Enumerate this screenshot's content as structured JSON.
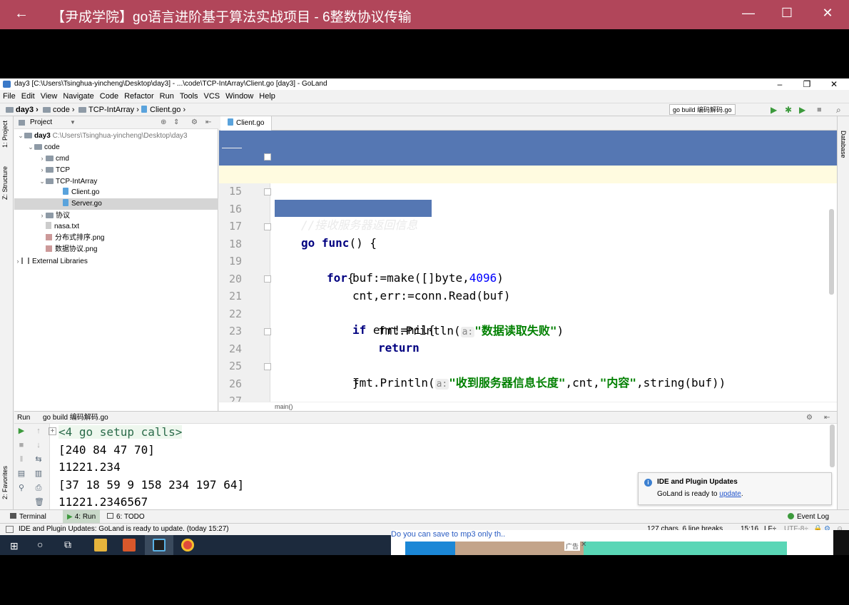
{
  "player": {
    "back_glyph": "←",
    "title": "【尹成学院】go语言进阶基于算法实战项目 - 6整数协议传输",
    "minimize": "—",
    "maximize": "☐",
    "close": "✕"
  },
  "ide": {
    "window_title": "day3 [C:\\Users\\Tsinghua-yincheng\\Desktop\\day3] - ...\\code\\TCP-IntArray\\Client.go [day3] - GoLand",
    "menu": [
      "File",
      "Edit",
      "View",
      "Navigate",
      "Code",
      "Refactor",
      "Run",
      "Tools",
      "VCS",
      "Window",
      "Help"
    ],
    "breadcrumb": [
      "day3",
      "code",
      "TCP-IntArray",
      "Client.go"
    ],
    "run_config": "go build 编码解码.go",
    "left_tabs": [
      "1: Project",
      "Z: Structure",
      "2: Favorites"
    ],
    "right_tabs": [
      "Database"
    ]
  },
  "project": {
    "header": "Project",
    "tree": [
      {
        "label": "day3",
        "path": "C:\\Users\\Tsinghua-yincheng\\Desktop\\day3",
        "kind": "folder",
        "open": true
      },
      {
        "label": "code",
        "kind": "folder",
        "open": true
      },
      {
        "label": "cmd",
        "kind": "folder",
        "open": false
      },
      {
        "label": "TCP",
        "kind": "folder",
        "open": false
      },
      {
        "label": "TCP-IntArray",
        "kind": "folder",
        "open": true
      },
      {
        "label": "Client.go",
        "kind": "go"
      },
      {
        "label": "Server.go",
        "kind": "go",
        "selected": true
      },
      {
        "label": "协议",
        "kind": "folder",
        "open": false
      },
      {
        "label": "nasa.txt",
        "kind": "file"
      },
      {
        "label": "分布式排序.png",
        "kind": "image"
      },
      {
        "label": "数据协议.png",
        "kind": "image"
      },
      {
        "label": "External Libraries",
        "kind": "lib"
      }
    ]
  },
  "editor": {
    "tab": "Client.go",
    "footer_crumb": "main()",
    "lines": [
      {
        "n": "13",
        "indent": 3
      },
      {
        "n": "14",
        "indent": 2
      },
      {
        "n": "15",
        "indent": 2
      },
      {
        "n": "16",
        "indent": 2
      },
      {
        "n": "17",
        "indent": 0
      },
      {
        "n": "18",
        "indent": 3
      },
      {
        "n": "19",
        "indent": 4
      },
      {
        "n": "20",
        "indent": 4
      },
      {
        "n": "21",
        "indent": 4
      },
      {
        "n": "22",
        "indent": 5
      },
      {
        "n": "23",
        "indent": 5
      },
      {
        "n": "24",
        "indent": 4
      },
      {
        "n": "25",
        "indent": 4
      },
      {
        "n": "26",
        "indent": 3
      },
      {
        "n": "27",
        "indent": 0
      }
    ],
    "code": {
      "l13_kw": "return",
      "l14": "}",
      "l15": "//接收服务器返回信息",
      "l16_kw": "go func",
      "l16_rest": "() {",
      "l18_kw": "for",
      "l18_rest": "{",
      "l19_a": "buf:=make([]byte,",
      "l19_num": "4096",
      "l19_b": ")",
      "l20": "cnt,err:=conn.Read(buf)",
      "l21_kw": "if",
      "l21_rest": " err!=nil{",
      "l22_a": "fmt.Println(",
      "l22_hint": "a:",
      "l22_str": "\"数据读取失败\"",
      "l22_b": ")",
      "l23_kw": "return",
      "l24": "}",
      "l25_a": "fmt.Println(",
      "l25_hint": "a:",
      "l25_str1": "\"收到服务器信息长度\"",
      "l25_mid": ",cnt,",
      "l25_str2": "\"内容\"",
      "l25_b": ",string(buf))",
      "l26": "}"
    }
  },
  "run": {
    "tab_label": "Run",
    "config": "go build 编码解码.go",
    "output": [
      "<4 go setup calls>",
      "[240 84 47 70]",
      "11221.234",
      "[37 18 59 9 158 234 197 64]",
      "11221.2346567"
    ]
  },
  "notification": {
    "title": "IDE and Plugin Updates",
    "body": "GoLand is ready to",
    "link": "update",
    "tail": "."
  },
  "bottom_tabs": [
    "Terminal",
    "4: Run",
    "6: TODO"
  ],
  "event_log": "Event Log",
  "status": {
    "message": "IDE and Plugin Updates: GoLand is ready to update. (today 15:27)",
    "chars": "127 chars, 6 line breaks",
    "position": "15:16",
    "line_sep": "LF÷",
    "encoding": "UTF-8÷"
  },
  "ad": {
    "text": "Do you can save to mp3 only th..",
    "badge": "广告"
  }
}
